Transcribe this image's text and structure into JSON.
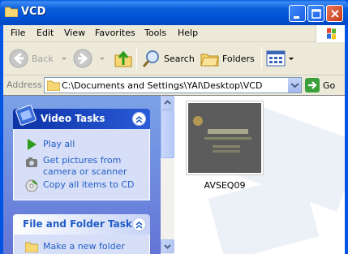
{
  "window": {
    "title": "VCD",
    "buttons": [
      "minimize",
      "maximize",
      "close"
    ]
  },
  "menu": {
    "items": [
      "File",
      "Edit",
      "View",
      "Favorites",
      "Tools",
      "Help"
    ]
  },
  "toolbar": {
    "back_label": "Back",
    "search_label": "Search",
    "folders_label": "Folders"
  },
  "address": {
    "label": "Address",
    "path": "C:\\Documents and Settings\\YAI\\Desktop\\VCD",
    "go_label": "Go"
  },
  "tasks": {
    "video_title": "Video Tasks",
    "video_links": [
      "Play all",
      "Get pictures from camera or scanner",
      "Copy all items to CD"
    ],
    "file_title": "File and Folder Tasks",
    "file_links": [
      "Make a new folder"
    ]
  },
  "files": [
    {
      "name": "AVSEQ09"
    }
  ],
  "colors": {
    "titlebar": "#0a5fd8",
    "task_link": "#215dc6",
    "pane_bg": "#6b8fe0"
  }
}
